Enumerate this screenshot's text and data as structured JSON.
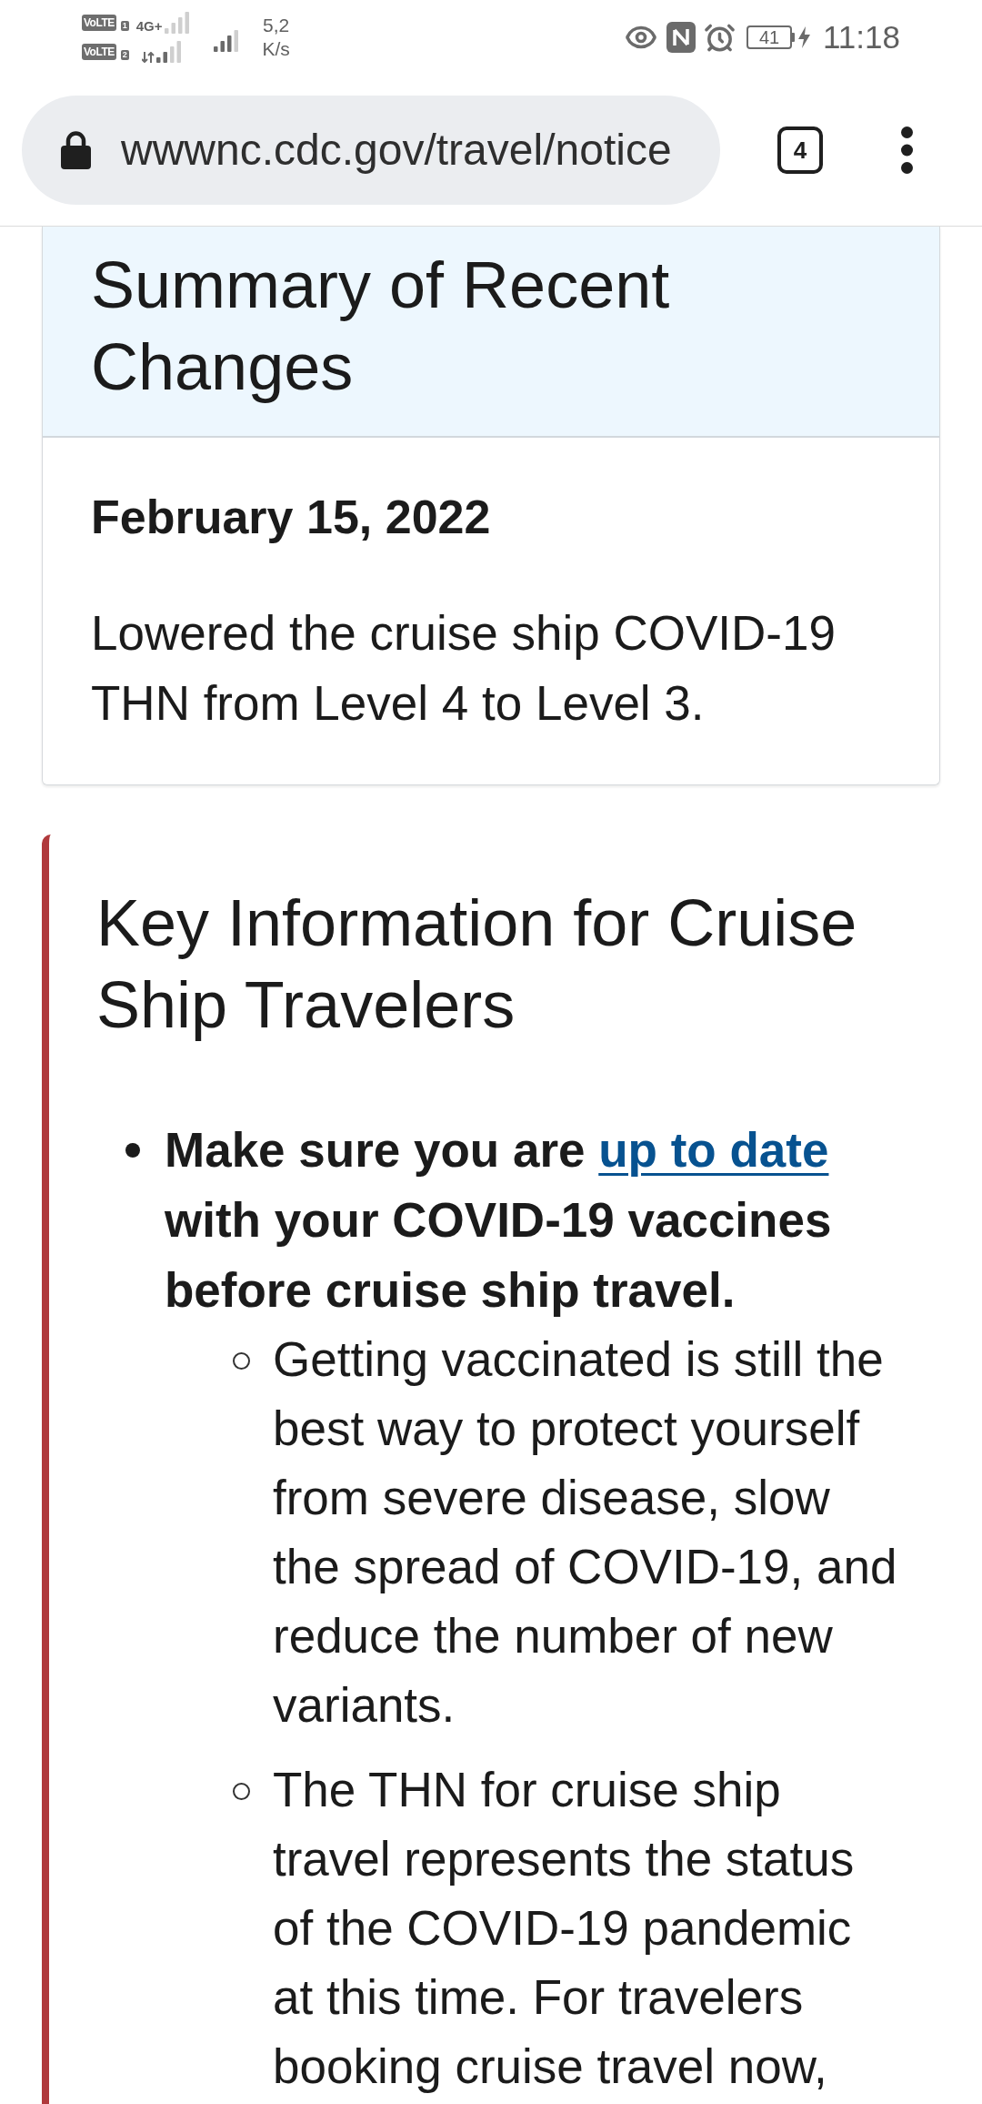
{
  "status_bar": {
    "sim_badges": [
      {
        "label": "VoLTE",
        "slot": "1"
      },
      {
        "label": "VoLTE",
        "slot": "2"
      }
    ],
    "network": "4G+",
    "speed": "5,2",
    "speed_unit": "K/s",
    "battery": "41",
    "charging": true,
    "time": "11:18"
  },
  "browser": {
    "url": "wwwnc.cdc.gov/travel/notice",
    "tab_count": "4"
  },
  "summary": {
    "title": "Summary of Recent Changes",
    "date": "February 15, 2022",
    "text": "Lowered the cruise ship COVID-19 THN from Level 4 to Level 3."
  },
  "key_info": {
    "title": "Key Information for Cruise Ship Travelers",
    "items": [
      {
        "text_before": "Make sure you are",
        "link": "up to date",
        "text_after": "with your COVID-19 vaccines before cruise ship travel.",
        "children": [
          {
            "text": "Getting vaccinated is still the best way to protect yourself from severe disease, slow the spread of COVID-19, and reduce the number of new variants."
          },
          {
            "text": "The THN for cruise ship travel represents the status of the COVID-19 pandemic at this time. For travelers booking cruise travel now,"
          }
        ]
      }
    ]
  }
}
